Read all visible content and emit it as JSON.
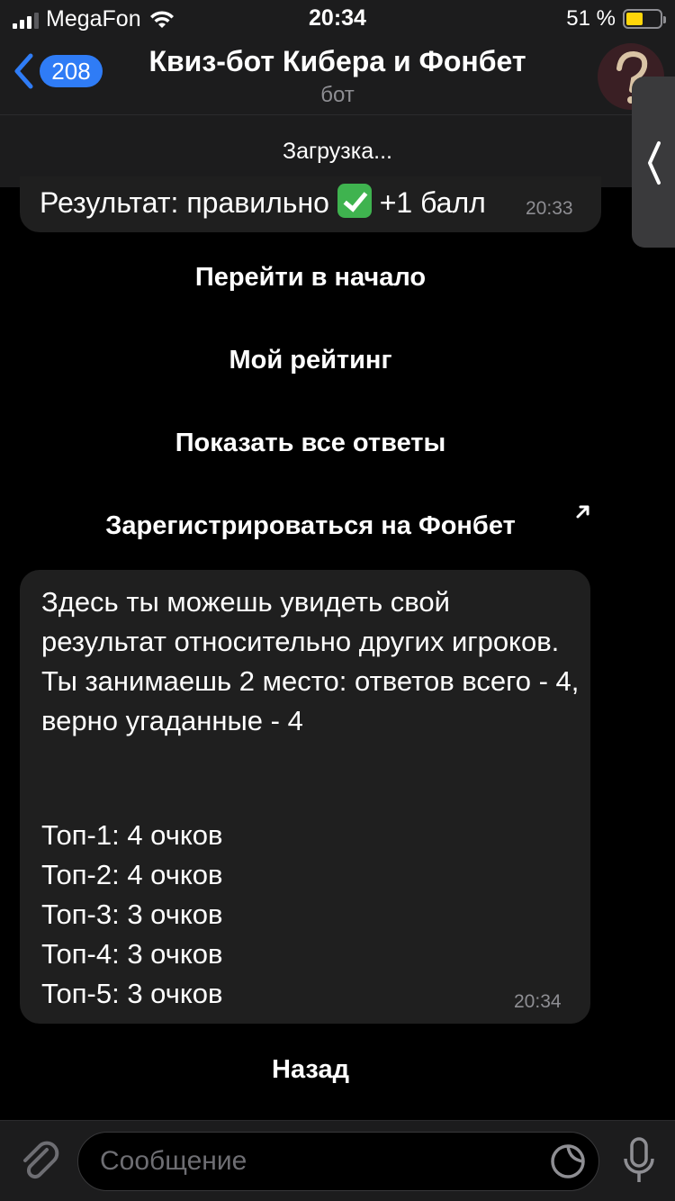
{
  "status_bar": {
    "carrier": "MegaFon",
    "time": "20:34",
    "battery_percent": "51 %",
    "battery_level": 0.51
  },
  "header": {
    "back_badge": "208",
    "title": "Квиз-бот Кибера и Фонбет",
    "subtitle": "бот"
  },
  "loading_text": "Загрузка...",
  "messages": {
    "result": {
      "text_before": "Результат: правильно",
      "emoji": "check-mark-icon",
      "text_after": "+1 балл",
      "time": "20:33"
    },
    "keyboard": [
      {
        "label": "Перейти в начало"
      },
      {
        "label": "Мой рейтинг"
      },
      {
        "label": "Показать все ответы"
      },
      {
        "label": "Зарегистрироваться на Фонбет",
        "url_icon": "arrow-up-right-icon"
      }
    ],
    "rating": {
      "paragraph": "Здесь ты можешь увидеть свой результат относительно других игроков. Ты занимаешь 2 место: ответов всего - 4, верно угаданные - 4",
      "tops": [
        "Топ-1: 4 очков",
        "Топ-2: 4 очков",
        "Топ-3: 3 очков",
        "Топ-4: 3 очков",
        "Топ-5: 3 очков"
      ],
      "time": "20:34"
    },
    "back_button": "Назад"
  },
  "input": {
    "placeholder": "Сообщение",
    "value": ""
  },
  "colors": {
    "accent": "#2f7cf6",
    "bubble": "#1f1f1f",
    "bar": "#1c1c1d",
    "battery": "#ffd60a"
  }
}
